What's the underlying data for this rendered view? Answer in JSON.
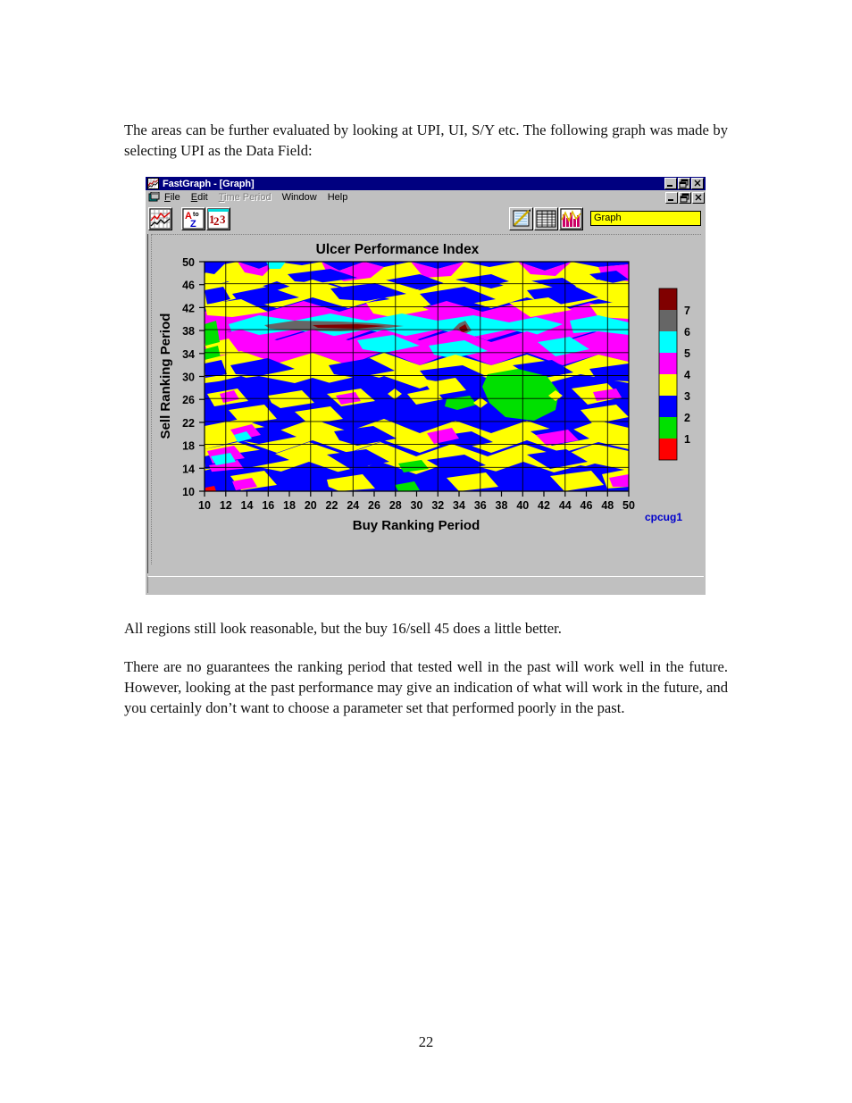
{
  "document": {
    "paragraph_intro": "The areas can be further evaluated by looking at UPI, UI, S/Y etc.  The following graph was made by selecting UPI as the Data Field:",
    "paragraph_mid": "All regions still look reasonable, but the buy 16/sell 45 does a little better.",
    "paragraph_end": "There are no guarantees the ranking period that tested well in the past will work well in the future.  However, looking at the past performance may give an indication of what will work in the future, and you certainly don’t want to choose a parameter set that performed poorly in the past.",
    "page_number": "22"
  },
  "window": {
    "title": "FastGraph - [Graph]",
    "icon": "fastgraph-app-icon",
    "controls": {
      "minimize": "_",
      "restore": "❐",
      "close": "✕"
    },
    "menu": [
      {
        "label": "File",
        "accel": "F",
        "disabled": false
      },
      {
        "label": "Edit",
        "accel": "E",
        "disabled": false
      },
      {
        "label": "Time Period",
        "accel": "T",
        "disabled": true
      },
      {
        "label": "Window",
        "accel": "W",
        "disabled": false
      },
      {
        "label": "Help",
        "accel": "H",
        "disabled": false
      }
    ],
    "toolbar": {
      "left_buttons": [
        {
          "name": "line-chart-icon",
          "tip": "Chart"
        },
        {
          "name": "sort-a-to-z-icon",
          "tip": "Sort A to Z"
        },
        {
          "name": "sort-numeric-icon",
          "tip": "Sort 1 2 3"
        }
      ],
      "right_buttons": [
        {
          "name": "notepad-pencil-icon",
          "tip": "Notes"
        },
        {
          "name": "table-grid-icon",
          "tip": "Table"
        },
        {
          "name": "bar-chart-icon",
          "tip": "Graph"
        }
      ],
      "field_value": "Graph",
      "field_placeholder": "Graph"
    }
  },
  "chart_data": {
    "type": "heatmap",
    "title": "Ulcer Performance Index",
    "xlabel": "Buy Ranking Period",
    "ylabel": "Sell Ranking Period",
    "watermark": "cpcug1",
    "xlim": [
      10,
      50
    ],
    "ylim": [
      10,
      50
    ],
    "xticks": [
      10,
      12,
      14,
      16,
      18,
      20,
      22,
      24,
      26,
      28,
      30,
      32,
      34,
      36,
      38,
      40,
      42,
      44,
      46,
      48,
      50
    ],
    "yticks": [
      10,
      14,
      18,
      22,
      26,
      30,
      34,
      38,
      42,
      46,
      50
    ],
    "grid": true,
    "legend": {
      "position": "right",
      "labels": [
        "7",
        "6",
        "5",
        "4",
        "3",
        "2",
        "1"
      ],
      "band_colors": [
        "#800000",
        "#666666",
        "#00ffff",
        "#ff00ff",
        "#ffff00",
        "#0000ff",
        "#00e000",
        "#ff0000"
      ]
    },
    "colors": {
      "level_8_darkred": "#800000",
      "level_7_gray": "#666666",
      "level_6_cyan": "#00ffff",
      "level_5_magenta": "#ff00ff",
      "level_4_yellow": "#ffff00",
      "level_3_blue": "#0000ff",
      "level_2_green": "#00e000",
      "level_1_red": "#ff0000"
    },
    "notes": "Contour/region map of Ulcer Performance Index over buy (x) and sell (y) ranking periods 10-50. Highest values (dark red / gray, level 6-7) occur in a narrow horizontal band near sell period 39-40 for buy periods 14-26, with smaller peaks near buy 34/sell 38 and buy 44/sell 34. Cyan (5) and magenta (4) surround those peaks across sell 33-43. Much of the lower half (sell 10-32) is blue (2) and yellow (3), with a broad green (1) low region near buy 34-42 / sell 25-32."
  }
}
